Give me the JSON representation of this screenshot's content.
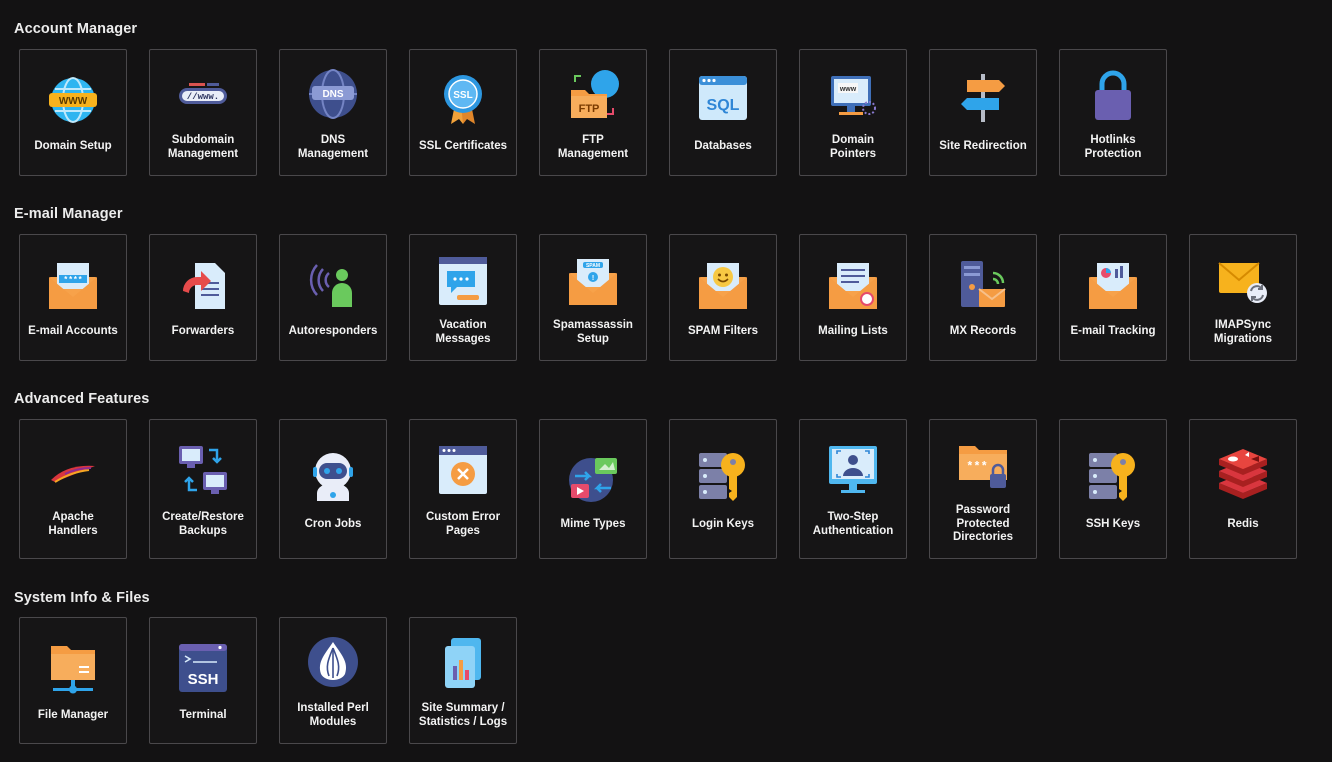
{
  "sections": [
    {
      "title": "Account Manager",
      "items": [
        {
          "label": "Domain Setup",
          "icon": "www-globe-icon"
        },
        {
          "label": "Subdomain\nManagement",
          "icon": "www-bar-icon"
        },
        {
          "label": "DNS\nManagement",
          "icon": "dns-globe-icon"
        },
        {
          "label": "SSL Certificates",
          "icon": "ssl-badge-icon"
        },
        {
          "label": "FTP\nManagement",
          "icon": "ftp-folder-icon"
        },
        {
          "label": "Databases",
          "icon": "sql-window-icon"
        },
        {
          "label": "Domain\nPointers",
          "icon": "domain-monitor-icon"
        },
        {
          "label": "Site Redirection",
          "icon": "signpost-icon"
        },
        {
          "label": "Hotlinks\nProtection",
          "icon": "padlock-icon"
        }
      ]
    },
    {
      "title": "E-mail Manager",
      "items": [
        {
          "label": "E-mail Accounts",
          "icon": "mail-password-icon"
        },
        {
          "label": "Forwarders",
          "icon": "forward-document-icon"
        },
        {
          "label": "Autoresponders",
          "icon": "person-broadcast-icon"
        },
        {
          "label": "Vacation\nMessages",
          "icon": "chat-window-icon"
        },
        {
          "label": "Spamassassin\nSetup",
          "icon": "spam-mail-icon"
        },
        {
          "label": "SPAM Filters",
          "icon": "smiley-mail-icon"
        },
        {
          "label": "Mailing Lists",
          "icon": "mailing-list-icon"
        },
        {
          "label": "MX Records",
          "icon": "mx-server-icon"
        },
        {
          "label": "E-mail Tracking",
          "icon": "mail-chart-icon"
        },
        {
          "label": "IMAPSync\nMigrations",
          "icon": "mail-sync-icon"
        }
      ]
    },
    {
      "title": "Advanced Features",
      "items": [
        {
          "label": "Apache\nHandlers",
          "icon": "apache-feather-icon"
        },
        {
          "label": "Create/Restore\nBackups",
          "icon": "backup-monitors-icon"
        },
        {
          "label": "Cron Jobs",
          "icon": "robot-icon"
        },
        {
          "label": "Custom Error\nPages",
          "icon": "error-window-icon"
        },
        {
          "label": "Mime Types",
          "icon": "mime-globe-icon"
        },
        {
          "label": "Login Keys",
          "icon": "server-key-icon"
        },
        {
          "label": "Two-Step\nAuthentication",
          "icon": "face-scan-monitor-icon"
        },
        {
          "label": "Password\nProtected\nDirectories",
          "icon": "locked-folder-icon"
        },
        {
          "label": "SSH Keys",
          "icon": "ssh-key-icon"
        },
        {
          "label": "Redis",
          "icon": "redis-icon"
        }
      ]
    },
    {
      "title": "System Info & Files",
      "items": [
        {
          "label": "File Manager",
          "icon": "network-folder-icon"
        },
        {
          "label": "Terminal",
          "icon": "ssh-terminal-icon"
        },
        {
          "label": "Installed Perl\nModules",
          "icon": "perl-onion-icon"
        },
        {
          "label": "Site Summary /\nStatistics / Logs",
          "icon": "statistics-icon"
        }
      ]
    }
  ]
}
